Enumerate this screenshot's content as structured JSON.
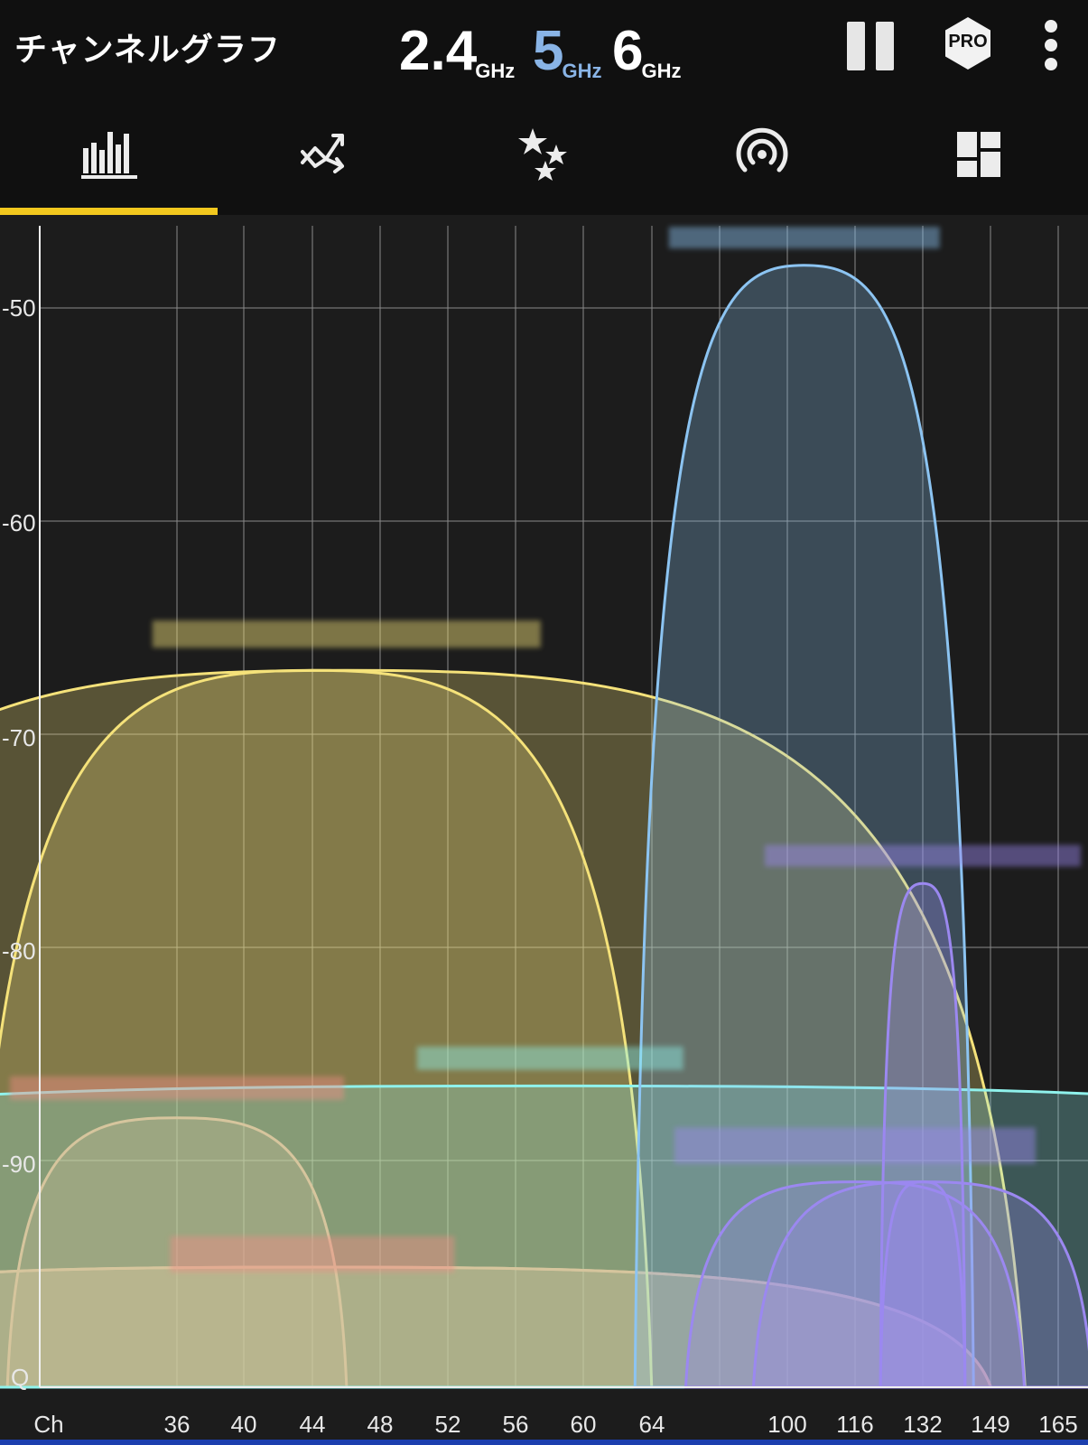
{
  "header": {
    "title": "チャンネルグラフ",
    "bands": [
      {
        "value": "2.4",
        "unit": "GHz"
      },
      {
        "value": "5",
        "unit": "GHz"
      },
      {
        "value": "6",
        "unit": "GHz"
      }
    ],
    "selected_band": "5",
    "pro_label": "PRO"
  },
  "tabs": [
    {
      "icon": "bar-chart-icon",
      "selected": true
    },
    {
      "icon": "time-graph-icon",
      "selected": false
    },
    {
      "icon": "rating-stars-icon",
      "selected": false
    },
    {
      "icon": "access-point-icon",
      "selected": false
    },
    {
      "icon": "dashboard-icon",
      "selected": false
    }
  ],
  "graph": {
    "y_labels": [
      "-50",
      "-60",
      "-70",
      "-80",
      "-90",
      "Q"
    ],
    "x_title": "Ch",
    "x_labels": [
      "36",
      "40",
      "44",
      "48",
      "52",
      "56",
      "60",
      "64",
      "100",
      "116",
      "132",
      "149",
      "165"
    ]
  },
  "colors": {
    "red": "#f28b86",
    "yellow": "#f5e27a",
    "cyan": "#8ff2ec",
    "blue": "#8cc4f2",
    "violet": "#9b88f0",
    "accent": "#f2c81e",
    "band_selected": "#89b4e6"
  },
  "chart_data": {
    "type": "area",
    "xlabel": "Ch",
    "ylabel": "",
    "ylim": [
      -100,
      -46
    ],
    "x_ticks": [
      "36",
      "40",
      "44",
      "48",
      "52",
      "56",
      "60",
      "64",
      "100",
      "116",
      "132",
      "149",
      "165"
    ],
    "y_ticks": [
      -50,
      -60,
      -70,
      -80,
      -90
    ],
    "grid": true,
    "series": [
      {
        "color": "red",
        "center": "36",
        "width": 20,
        "peak": -88
      },
      {
        "color": "red",
        "center": "44",
        "width": 80,
        "peak": -95
      },
      {
        "color": "red",
        "center": "44",
        "width": 80,
        "peak": -95
      },
      {
        "color": "yellow",
        "center": "44",
        "width": 40,
        "peak": -67
      },
      {
        "color": "yellow",
        "center": "46",
        "width": 80,
        "peak": -67
      },
      {
        "color": "cyan",
        "center": "58",
        "width": 160,
        "peak": -86.5
      },
      {
        "color": "blue",
        "center": "104",
        "width": 80,
        "peak": -48
      },
      {
        "color": "violet",
        "center": "132",
        "width": 20,
        "peak": -77
      },
      {
        "color": "violet",
        "center": "132",
        "width": 20,
        "peak": -91
      },
      {
        "color": "violet",
        "center": "116",
        "width": 80,
        "peak": -91
      },
      {
        "color": "violet",
        "center": "132",
        "width": 80,
        "peak": -91
      }
    ]
  }
}
